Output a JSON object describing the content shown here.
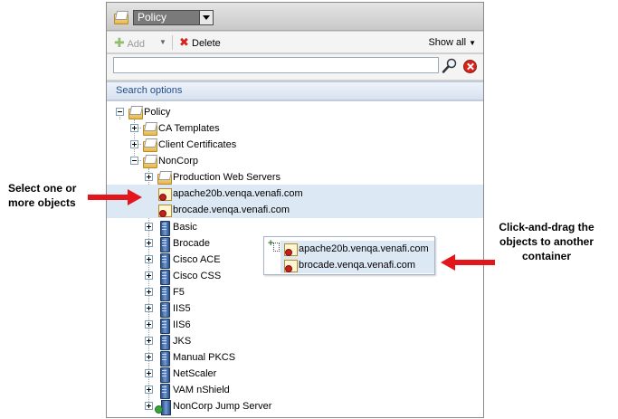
{
  "header": {
    "select_value": "Policy"
  },
  "toolbar": {
    "add_label": "Add",
    "delete_label": "Delete",
    "show_all_label": "Show all"
  },
  "search": {
    "value": "",
    "placeholder": ""
  },
  "search_options_label": "Search options",
  "tree": {
    "root": "Policy",
    "ca_templates": "CA Templates",
    "client_certificates": "Client Certificates",
    "noncorp": "NonCorp",
    "production_web_servers": "Production Web Servers",
    "cert1": "apache20b.venqa.venafi.com",
    "cert2": "brocade.venqa.venafi.com",
    "devices": [
      "Basic",
      "Brocade",
      "Cisco ACE",
      "Cisco CSS",
      "F5",
      "IIS5",
      "IIS6",
      "JKS",
      "Manual PKCS",
      "NetScaler",
      "VAM nShield"
    ],
    "jump_server": "NonCorp Jump Server"
  },
  "drag": {
    "item1": "apache20b.venqa.venafi.com",
    "item2": "brocade.venqa.venafi.com"
  },
  "annotations": {
    "left": "Select one or more objects",
    "right": "Click-and-drag the objects to another container"
  },
  "colors": {
    "arrow": "#e3171b",
    "selection": "#dde8f5",
    "search_options_text": "#1f4e8c"
  }
}
